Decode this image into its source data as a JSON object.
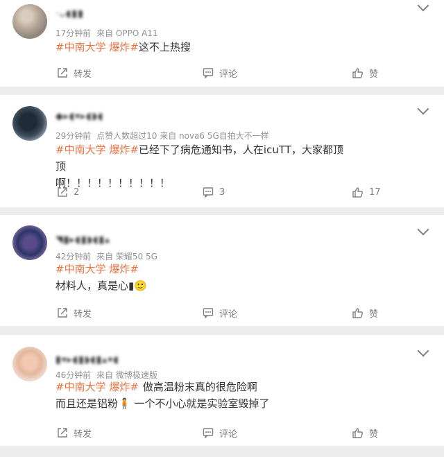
{
  "comments": [
    {
      "username": "·ᴗ◖▮▮",
      "time": "17分钟前",
      "source": "来自 OPPO A11",
      "hashtag": "#中南大学 爆炸#",
      "text_lines": [
        "这不上热搜"
      ],
      "share": "转发",
      "comment": "评论",
      "like": "赞"
    },
    {
      "username": "◆▸◖▾▸◖◗◖",
      "time": "29分钟前",
      "source": "点赞人数超过10 来自 nova6 5G自拍大不一样",
      "hashtag": "#中南大学 爆炸#",
      "text_lines": [
        "已经下了病危通知书，人在icuTT，大家都顶顶",
        "啊！！！！！！！！！！"
      ],
      "share": "2",
      "comment": "3",
      "like": "17"
    },
    {
      "username": "◥▮▸◖▮◗◖▮▴",
      "time": "42分钟前",
      "source": "来自 荣耀50 5G",
      "hashtag": "#中南大学 爆炸#",
      "text_lines": [
        "材料人，真是心▮🙂"
      ],
      "share": "转发",
      "comment": "评论",
      "like": "赞"
    },
    {
      "username": "▮▾▸◖▮◗◖▮▴▾◖",
      "time": "46分钟前",
      "source": "来自 微博极速版",
      "hashtag": "#中南大学 爆炸#",
      "text_lines": [
        "做高温粉末真的很危险啊",
        "而且还是铝粉🧍 一个不小心就是实验室毁掉了"
      ],
      "share": "转发",
      "comment": "评论",
      "like": "赞"
    }
  ],
  "icons": {
    "share": "share-icon",
    "comment": "comment-icon",
    "like": "thumbs-up-icon",
    "menu": "chevron-down-icon"
  },
  "colors": {
    "hashtag": "#eb7340",
    "meta": "#939393",
    "text": "#333333",
    "action": "#808080",
    "background": "#ededed"
  }
}
